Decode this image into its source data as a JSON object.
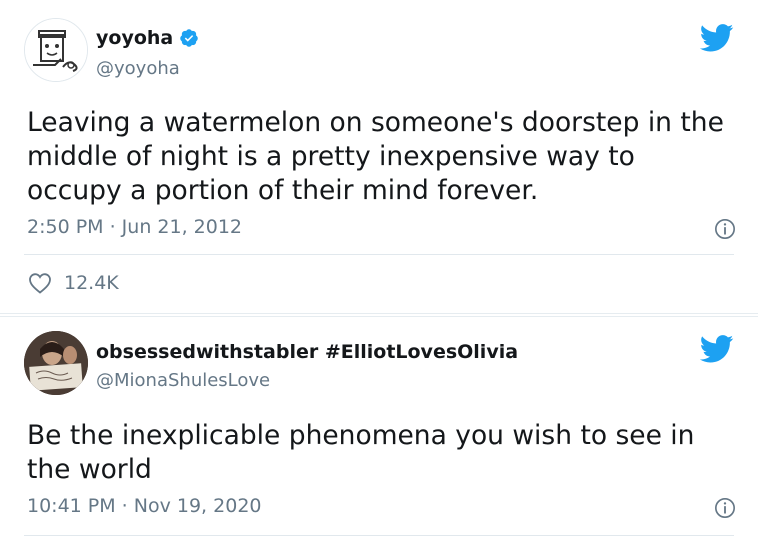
{
  "tweets": [
    {
      "display_name": "yoyoha",
      "handle": "@yoyoha",
      "verified": true,
      "text": "Leaving a watermelon on someone's doorstep in the middle of night is a pretty inexpensive way to occupy a portion of their mind forever.",
      "timestamp": "2:50 PM · Jun 21, 2012",
      "likes": "12.4K"
    },
    {
      "display_name": "obsessedwithstabler #ElliotLovesOlivia",
      "handle": "@MionaShulesLove",
      "verified": false,
      "text": "Be the inexplicable phenomena you wish to see in the world",
      "timestamp": "10:41 PM · Nov 19, 2020"
    }
  ],
  "colors": {
    "twitter_blue": "#1DA1F2",
    "secondary_text": "#657786",
    "divider": "#E1E8ED"
  },
  "icons": [
    "twitter-bird-icon",
    "verified-badge-icon",
    "info-icon",
    "heart-icon"
  ]
}
